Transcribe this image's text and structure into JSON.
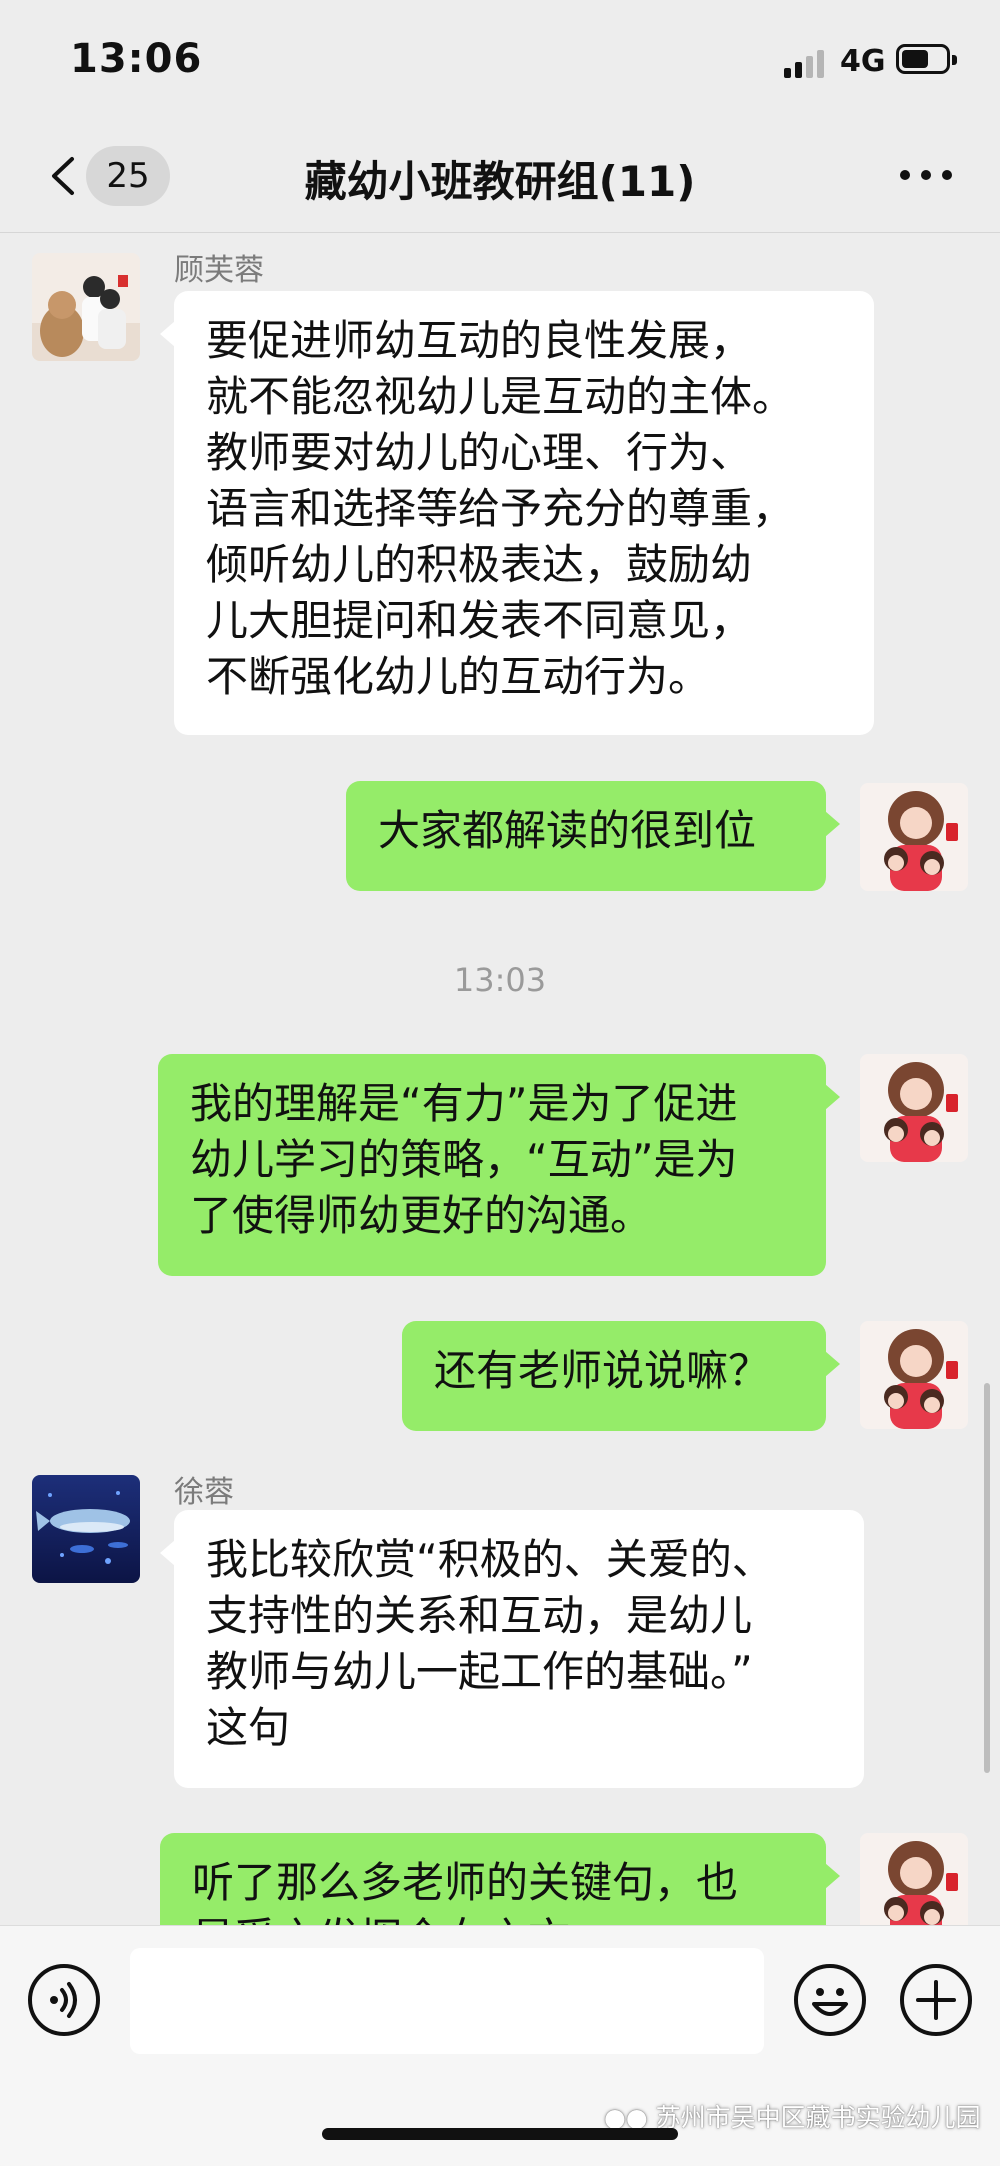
{
  "status_bar": {
    "time": "13:06",
    "network": "4G",
    "battery_level": 0.6
  },
  "nav": {
    "unread_count": "25",
    "title": "藏幼小班教研组(11)",
    "back_icon": "chevron-left-icon",
    "more_icon": "more-dots-icon"
  },
  "messages": [
    {
      "side": "in",
      "sender": "顾芙蓉",
      "lines": [
        "要促进师幼互动的良性发展，",
        "就不能忽视幼儿是互动的主体。",
        "教师要对幼儿的心理、行为、",
        "语言和选择等给予充分的尊重，",
        "倾听幼儿的积极表达，鼓励幼",
        "儿大胆提问和发表不同意见，",
        "不断强化幼儿的互动行为。"
      ]
    },
    {
      "side": "out",
      "lines": [
        "大家都解读的很到位"
      ]
    },
    {
      "timestamp": "13:03"
    },
    {
      "side": "out",
      "lines": [
        "我的理解是“有力”是为了促进",
        "幼儿学习的策略，“互动”是为",
        "了使得师幼更好的沟通。"
      ]
    },
    {
      "side": "out",
      "lines": [
        "还有老师说说嘛？"
      ]
    },
    {
      "side": "in",
      "sender": "徐蓉",
      "lines": [
        "我比较欣赏“积极的、关爱的、",
        "支持性的关系和互动，是幼儿",
        "教师与幼儿一起工作的基础。”",
        "这句"
      ]
    },
    {
      "side": "out",
      "lines": [
        "听了那么多老师的关键句，也",
        "是受之发挥全女之文"
      ]
    }
  ],
  "input_bar": {
    "voice_icon": "voice-icon",
    "emoji_icon": "emoji-icon",
    "plus_icon": "plus-icon",
    "input_value": ""
  },
  "watermark": {
    "text": "苏州市吴中区藏书实验幼儿园",
    "icon": "wechat-icon"
  },
  "colors": {
    "outgoing_bubble": "#95ec69",
    "incoming_bubble": "#ffffff",
    "background": "#ededed"
  }
}
